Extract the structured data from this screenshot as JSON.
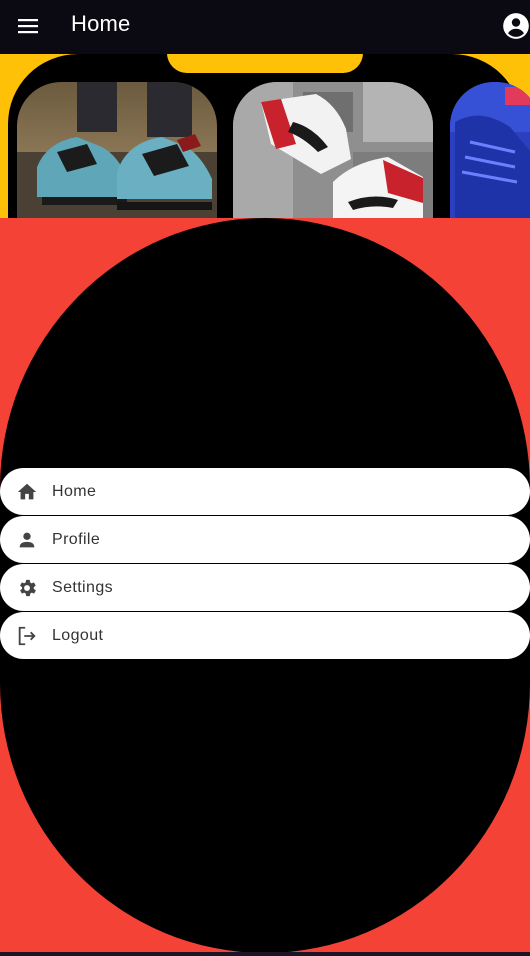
{
  "appbar": {
    "title": "Home",
    "menu_icon": "hamburger-menu-icon",
    "account_icon": "account-circle-icon"
  },
  "carousel": {
    "items": [
      {
        "name": "sneaker-teal-black"
      },
      {
        "name": "sneaker-red-white"
      },
      {
        "name": "sneaker-blue-knit"
      }
    ]
  },
  "menu": {
    "items": [
      {
        "label": "Home",
        "icon": "home-icon"
      },
      {
        "label": "Profile",
        "icon": "person-icon"
      },
      {
        "label": "Settings",
        "icon": "gear-icon"
      },
      {
        "label": "Logout",
        "icon": "logout-icon"
      }
    ]
  },
  "colors": {
    "appbar_bg": "#0b0a12",
    "banner_yellow": "#ffc107",
    "page_red": "#f44336",
    "oval_black": "#000000",
    "menu_bg": "#ffffff",
    "icon_color": "#444444"
  }
}
